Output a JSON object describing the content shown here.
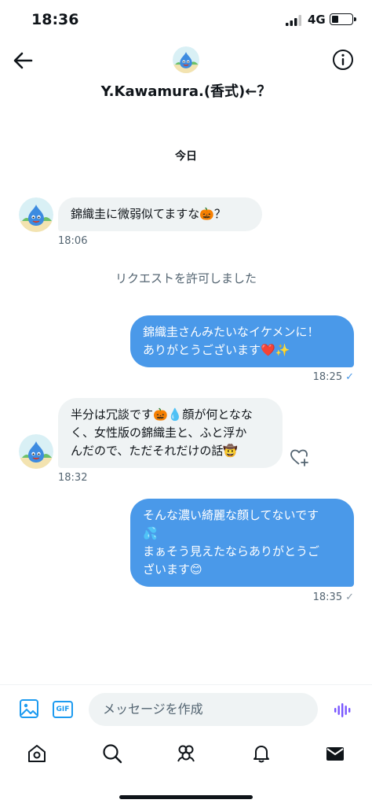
{
  "status_bar": {
    "time": "18:36",
    "network": "4G",
    "battery_level": 0.35
  },
  "header": {
    "title": "Y.Kawamura.(香式)←？"
  },
  "date_separator": "今日",
  "messages": [
    {
      "direction": "in",
      "lines": [
        "錦織圭に微弱似てますな🎃？"
      ],
      "time": "18:06"
    },
    {
      "direction": "system",
      "text": "リクエストを許可しました"
    },
    {
      "direction": "out",
      "lines": [
        "錦織圭さんみたいなイケメンに！",
        "ありがとうございます❤️✨"
      ],
      "time": "18:25",
      "status": "✓"
    },
    {
      "direction": "in",
      "lines": [
        "半分は冗談です🎃💧顔が何となな",
        "く、女性版の錦織圭と、ふと浮か",
        "んだので、ただそれだけの話🤠"
      ],
      "time": "18:32"
    },
    {
      "direction": "out",
      "lines": [
        "そんな濃い綺麗な顔してないです",
        "💦",
        "まぁそう見えたならありがとうご",
        "ざいます😊"
      ],
      "time": "18:35",
      "status": "✓"
    }
  ],
  "composer": {
    "placeholder": "メッセージを作成",
    "gif_label": "GIF"
  },
  "tabs": [
    "home-icon",
    "search-icon",
    "communities-icon",
    "notifications-icon",
    "messages-icon"
  ],
  "colors": {
    "accent": "#1d9bf0",
    "outgoing_bubble": "#4a99e9",
    "incoming_bubble": "#eff3f4"
  }
}
